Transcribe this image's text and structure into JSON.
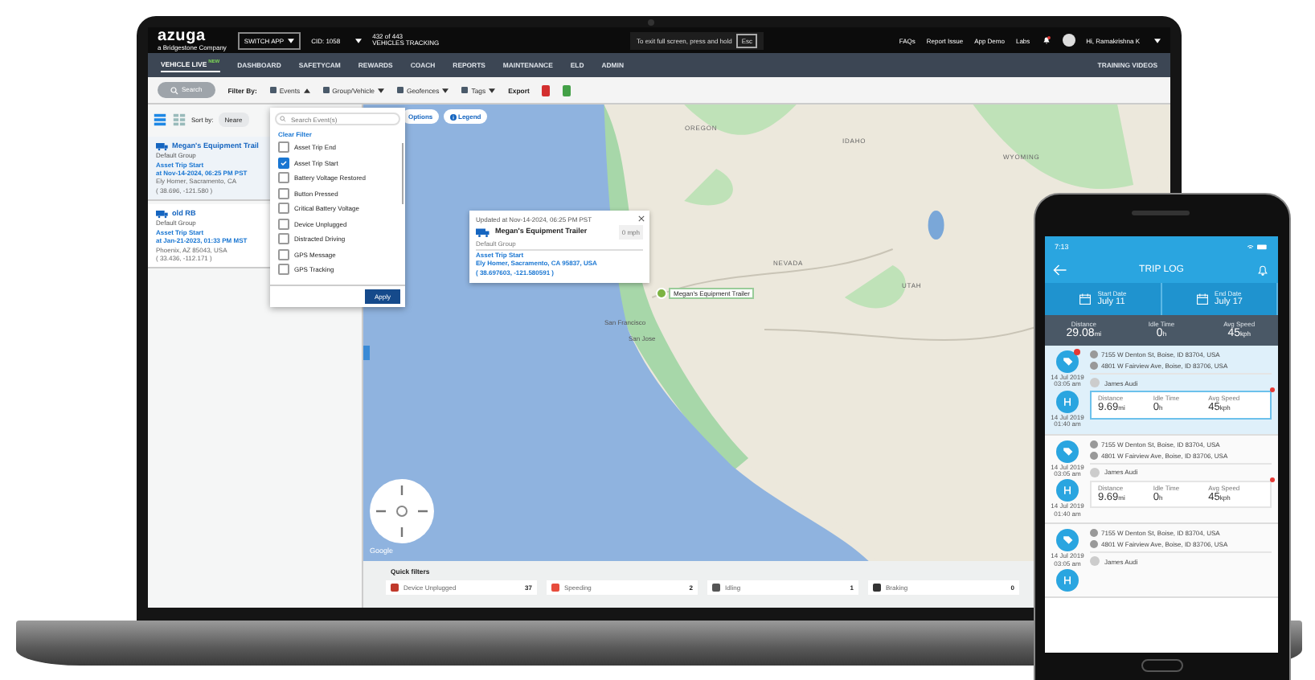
{
  "top_bar": {
    "logo": "azuga",
    "logo_tagline": "a Bridgestone Company",
    "app_switch": "SWITCH APP",
    "cid": "CID: 1058",
    "tracking_count": "432 of 443",
    "tracking_label": "VEHICLES TRACKING",
    "links": [
      "FAQs",
      "Report Issue",
      "App Demo",
      "Labs"
    ],
    "greeting": "Hi, Ramakrishna K"
  },
  "nav": {
    "items": [
      {
        "label": "VEHICLE LIVE",
        "badge": "NEW",
        "selected": true
      },
      {
        "label": "DASHBOARD",
        "selected": false
      },
      {
        "label": "SAFETYCAM",
        "selected": false
      },
      {
        "label": "REWARDS",
        "selected": false
      },
      {
        "label": "COACH",
        "selected": false
      },
      {
        "label": "REPORTS",
        "selected": false
      },
      {
        "label": "MAINTENANCE",
        "selected": false
      },
      {
        "label": "ELD",
        "selected": false
      },
      {
        "label": "ADMIN",
        "selected": false
      }
    ],
    "right_link": "TRAINING VIDEOS"
  },
  "fullscreen_notice": {
    "text": "To exit full screen, press and hold",
    "key": "Esc"
  },
  "filter_bar": {
    "search_button": "Search",
    "filter_label": "Filter By:",
    "filters": [
      {
        "label": "Events",
        "expanded": true
      },
      {
        "label": "Group/Vehicle",
        "expanded": false
      },
      {
        "label": "Geofences",
        "expanded": false
      },
      {
        "label": "Tags",
        "expanded": false
      }
    ],
    "export_label": "Export"
  },
  "list_panel": {
    "sort_label": "Sort by:",
    "sort_value": "Neare",
    "view_modes": [
      {
        "kind": "list",
        "selected": true
      },
      {
        "kind": "grid",
        "selected": false
      }
    ],
    "cards": [
      {
        "name": "Megan's Equipment Trail",
        "group": "Default Group",
        "event": "Asset Trip Start",
        "time": "at Nov-14-2024, 06:25 PM PST",
        "address": "Ely Homer, Sacramento, CA",
        "coords": "( 38.696, -121.580 )",
        "selected": true
      },
      {
        "name": "old RB",
        "group": "Default Group",
        "event": "Asset Trip Start",
        "time": "at Jan-21-2023, 01:33 PM MST",
        "address": "Phoenix, AZ 85043, USA",
        "coords": "( 33.436, -112.171 )",
        "selected": false
      }
    ]
  },
  "events_dropdown": {
    "placeholder": "Search Event(s)",
    "clear_filter": "Clear Filter",
    "options": [
      {
        "label": "Asset Trip End",
        "checked": false
      },
      {
        "label": "Asset Trip Start",
        "checked": true
      },
      {
        "label": "Battery Voltage Restored",
        "checked": false
      },
      {
        "label": "Button Pressed",
        "checked": false
      },
      {
        "label": "Critical Battery Voltage",
        "checked": false
      },
      {
        "label": "Device Unplugged",
        "checked": false
      },
      {
        "label": "Distracted Driving",
        "checked": false
      },
      {
        "label": "GPS Message",
        "checked": false
      },
      {
        "label": "GPS Tracking",
        "checked": false
      }
    ],
    "apply": "Apply"
  },
  "map": {
    "options_button": "Options",
    "legend_button": "Legend",
    "labels": [
      "OREGON",
      "IDAHO",
      "WYOMING",
      "NEVADA",
      "UTAH",
      "San Francisco",
      "San Jose"
    ],
    "popup": {
      "updated": "Updated at Nov-14-2024, 06:25 PM PST",
      "name": "Megan's Equipment Trailer",
      "speed": "0 mph",
      "group": "Default Group",
      "event": "Asset Trip Start",
      "address": "Ely Homer, Sacramento, CA 95837, USA",
      "coords": "( 38.697603, -121.580591 )"
    },
    "marker_label": "Megan's Equipment Trailer",
    "attribution": "Google"
  },
  "quick_filters": {
    "title": "Quick filters",
    "items": [
      {
        "label": "Device Unplugged",
        "count": "37"
      },
      {
        "label": "Speeding",
        "count": "2"
      },
      {
        "label": "Idling",
        "count": "1"
      },
      {
        "label": "Braking",
        "count": "0"
      }
    ]
  },
  "phone": {
    "clock": "7:13",
    "title": "TRIP LOG",
    "dates": [
      {
        "label": "Start Date",
        "value": "July 11"
      },
      {
        "label": "End Date",
        "value": "July 17"
      }
    ],
    "summary": [
      {
        "label": "Distance",
        "value": "29.08",
        "unit": "mi"
      },
      {
        "label": "Idle Time",
        "value": "0",
        "unit": "h"
      },
      {
        "label": "Avg Speed",
        "value": "45",
        "unit": "kph"
      }
    ],
    "trips": [
      {
        "selected": true,
        "alert": true,
        "start_date": "14 Jul 2019",
        "start_time": "03:05 am",
        "end_date": "14 Jul 2019",
        "end_time": "01:40 am",
        "from": "7155 W Denton St, Boise, ID 83704, USA",
        "to": "4801 W Fairview Ave, Boise, ID 83706, USA",
        "driver": "James Audi",
        "stats": [
          {
            "label": "Distance",
            "value": "9.69",
            "unit": "mi"
          },
          {
            "label": "Idle Time",
            "value": "0",
            "unit": "h"
          },
          {
            "label": "Avg Speed",
            "value": "45",
            "unit": "kph"
          }
        ]
      },
      {
        "selected": false,
        "alert": false,
        "start_date": "14 Jul 2019",
        "start_time": "03:05 am",
        "end_date": "14 Jul 2019",
        "end_time": "01:40 am",
        "from": "7155 W Denton St, Boise, ID 83704, USA",
        "to": "4801 W Fairview Ave, Boise, ID 83706, USA",
        "driver": "James Audi",
        "stats": [
          {
            "label": "Distance",
            "value": "9.69",
            "unit": "mi"
          },
          {
            "label": "Idle Time",
            "value": "0",
            "unit": "h"
          },
          {
            "label": "Avg Speed",
            "value": "45",
            "unit": "kph"
          }
        ]
      },
      {
        "selected": false,
        "alert": false,
        "start_date": "14 Jul 2019",
        "start_time": "03:05 am",
        "from": "7155 W Denton St, Boise, ID 83704, USA",
        "to": "4801 W Fairview Ave, Boise, ID 83706, USA",
        "driver": "James Audi"
      }
    ]
  }
}
